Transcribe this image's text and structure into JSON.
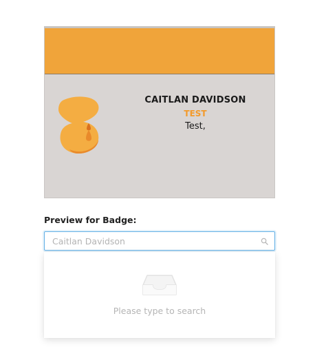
{
  "badge": {
    "header_color": "#f0a43a",
    "logo_icon": "eventbrite-logo-icon",
    "name": "CAITLAN DAVIDSON",
    "company": "TEST",
    "title": "Test,"
  },
  "preview": {
    "label": "Preview for Badge:",
    "search": {
      "value": "",
      "placeholder": "Caitlan Davidson",
      "icon": "search-icon"
    },
    "dropdown": {
      "empty_icon": "inbox-icon",
      "empty_text": "Please type to search"
    }
  },
  "colors": {
    "accent": "#f0a43a",
    "company_text": "#f39a2a",
    "focus_border": "#62b0e6",
    "badge_background": "#d9d5d3"
  }
}
